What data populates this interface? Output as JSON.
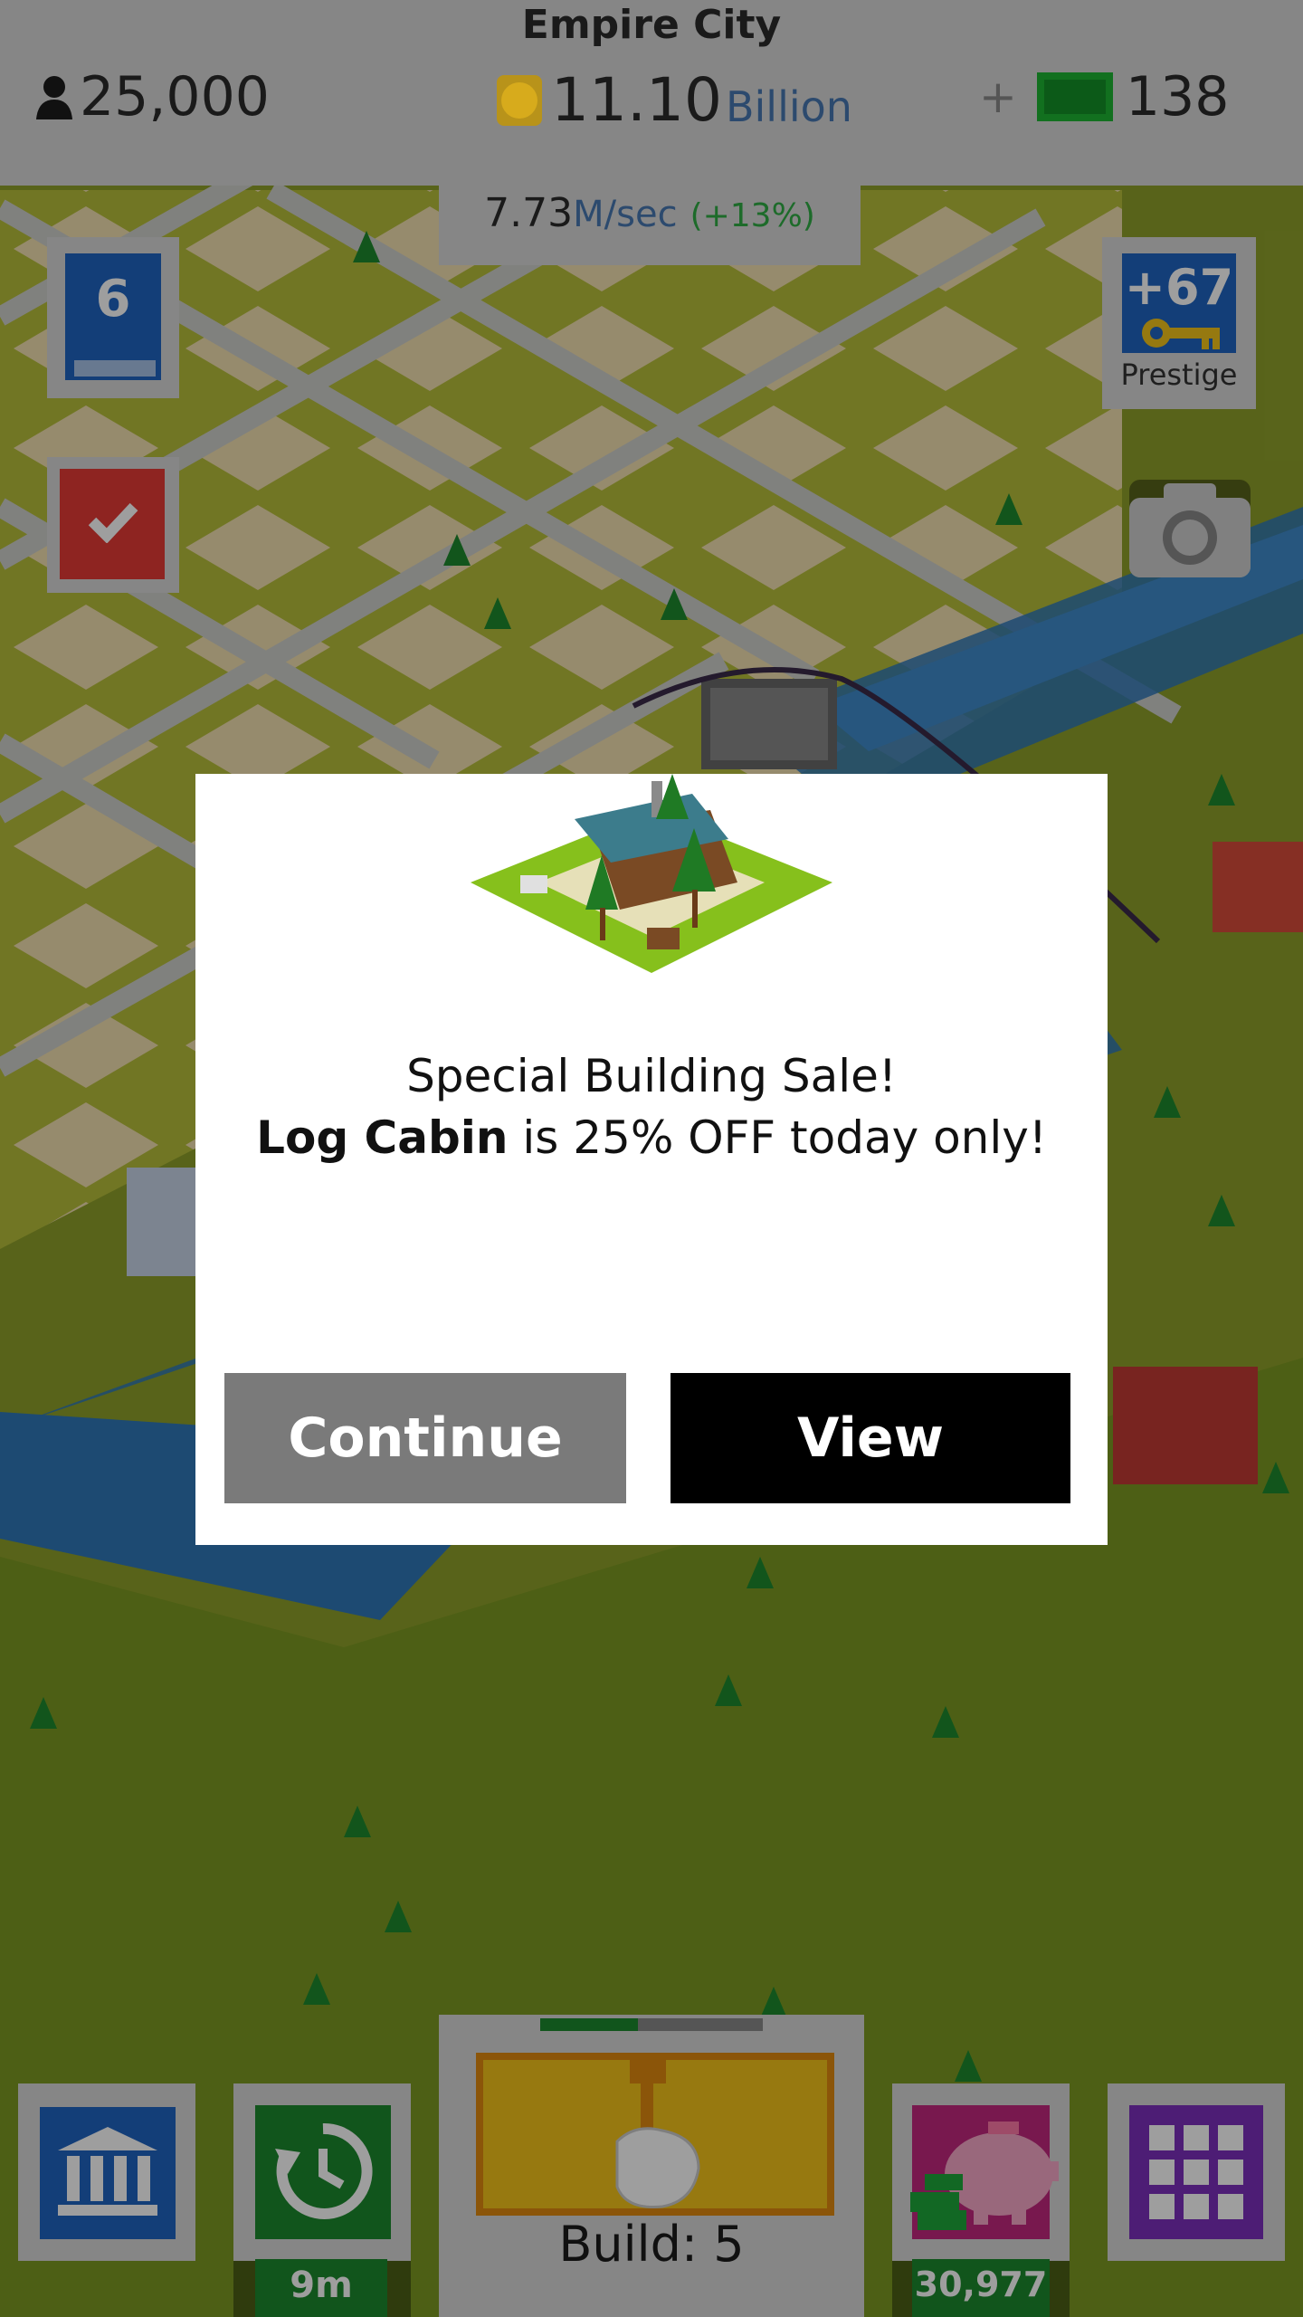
{
  "header": {
    "city_name": "Empire City",
    "population": "25,000",
    "coins_value": "11.10",
    "coins_unit": "Billion",
    "cash_plus": "+",
    "cash_value": "138",
    "rate_value": "7.73",
    "rate_unit": "M/sec",
    "rate_bonus": "(+13%)"
  },
  "side": {
    "level_number": "6",
    "prestige_value": "+67",
    "prestige_label": "Prestige"
  },
  "modal": {
    "line1": "Special Building Sale!",
    "line2_bold": "Log Cabin",
    "line2_rest": " is 25% OFF today only!",
    "continue_label": "Continue",
    "view_label": "View"
  },
  "bottom": {
    "timer_badge": "9m",
    "build_label": "Build: 5",
    "piggy_badge": "30,977"
  },
  "colors": {
    "bank_blue": "#1f64c2",
    "clock_green": "#1c8a2e",
    "build_yellow": "#f4c41a",
    "piggy_magenta": "#c2287e",
    "grid_purple": "#7d2fbd",
    "cash_green": "#1ea83a",
    "coin_gold": "#f2c31a"
  }
}
